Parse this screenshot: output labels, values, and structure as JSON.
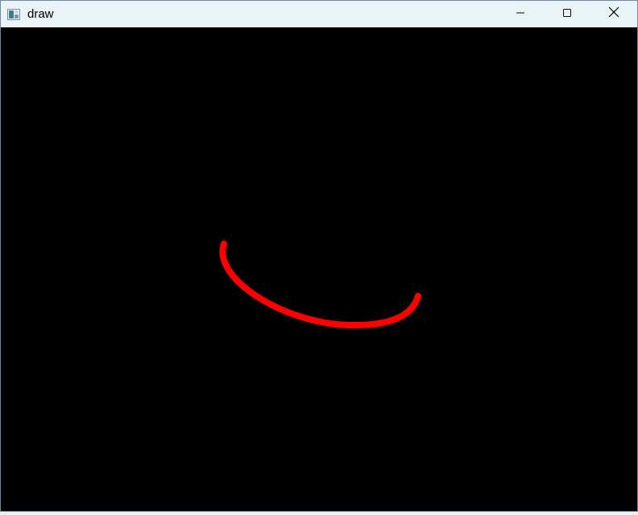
{
  "window": {
    "title": "draw",
    "icon": "app-window-icon",
    "controls": {
      "minimize_icon": "minimize-icon",
      "maximize_icon": "maximize-icon",
      "close_icon": "close-icon"
    }
  },
  "canvas": {
    "background_color": "#000000",
    "stroke": {
      "shape": "curved-stroke",
      "color": "#ff0000"
    }
  }
}
